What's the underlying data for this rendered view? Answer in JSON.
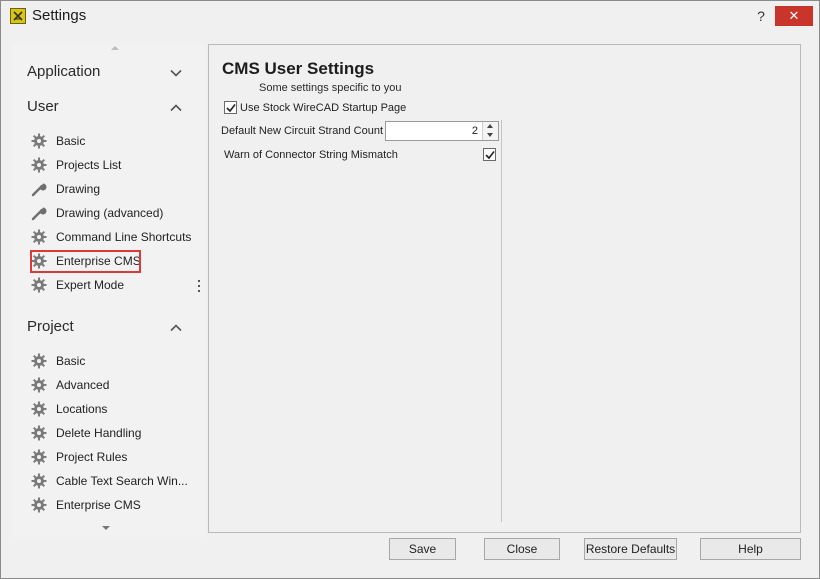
{
  "window": {
    "title": "Settings",
    "help_glyph": "?",
    "close_glyph": "✕"
  },
  "sidebar": {
    "sections": [
      {
        "label": "Application",
        "expanded": false,
        "items": []
      },
      {
        "label": "User",
        "expanded": true,
        "items": [
          {
            "label": "Basic",
            "icon": "gear-icon"
          },
          {
            "label": "Projects List",
            "icon": "gear-icon"
          },
          {
            "label": "Drawing",
            "icon": "wrench-icon"
          },
          {
            "label": "Drawing (advanced)",
            "icon": "wrench-icon"
          },
          {
            "label": "Command Line Shortcuts",
            "icon": "gear-icon"
          },
          {
            "label": "Enterprise CMS",
            "icon": "gear-icon",
            "selected": true
          },
          {
            "label": "Expert Mode",
            "icon": "gear-icon"
          }
        ]
      },
      {
        "label": "Project",
        "expanded": true,
        "items": [
          {
            "label": "Basic",
            "icon": "gear-icon"
          },
          {
            "label": "Advanced",
            "icon": "gear-icon"
          },
          {
            "label": "Locations",
            "icon": "gear-icon"
          },
          {
            "label": "Delete Handling",
            "icon": "gear-icon"
          },
          {
            "label": "Project Rules",
            "icon": "gear-icon"
          },
          {
            "label": "Cable Text Search Win...",
            "icon": "gear-icon"
          },
          {
            "label": "Enterprise CMS",
            "icon": "gear-icon"
          }
        ]
      }
    ]
  },
  "panel": {
    "title": "CMS User Settings",
    "subtitle": "Some settings specific to you",
    "use_stock_startup": {
      "label": "Use Stock WireCAD Startup Page",
      "checked": true
    },
    "strand_count": {
      "label": "Default New Circuit Strand Count",
      "value": "2"
    },
    "connector_warning": {
      "label": "Warn of Connector String Mismatch",
      "checked": true
    }
  },
  "footer": {
    "save": "Save",
    "close": "Close",
    "restore": "Restore Defaults",
    "help": "Help"
  },
  "colors": {
    "highlight": "#d93a3a",
    "close_button": "#c9352b",
    "app_icon": "#d7c51c"
  }
}
